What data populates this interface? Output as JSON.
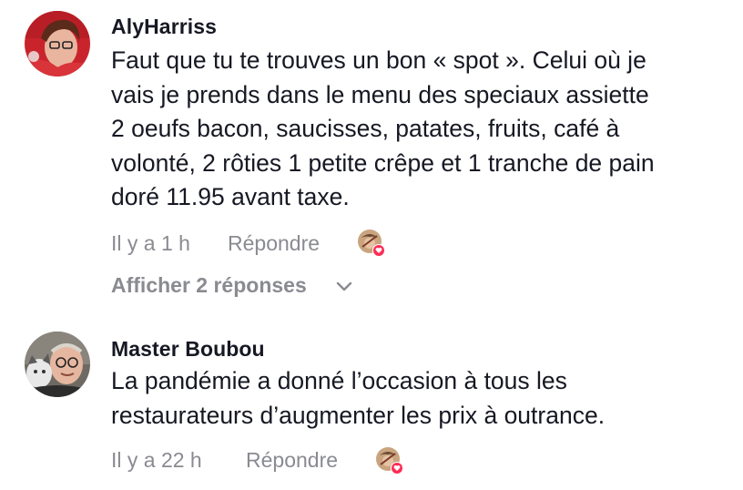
{
  "comments": [
    {
      "username": "AlyHarriss",
      "text_lines": [
        "Faut que tu te trouves un bon « spot ». Celui où je",
        "vais je prends dans le menu des speciaux assiette",
        "2 oeufs bacon, saucisses, patates, fruits, café à",
        "volonté, 2 rôties 1 petite crêpe et 1 tranche de pain",
        "doré 11.95 avant taxe."
      ],
      "time": "Il y a 1 h",
      "reply_label": "Répondre",
      "show_replies_label": "Afficher 2 réponses"
    },
    {
      "username": "Master Boubou",
      "text_lines": [
        "La pandémie a donné l’occasion à tous les",
        "restaurateurs d’augmenter les prix à outrance."
      ],
      "time": "Il y a 22 h",
      "reply_label": "Répondre"
    }
  ],
  "icons": {
    "liked_by_creator": "creator-avatar-with-heart-icon",
    "expand": "chevron-down-icon"
  },
  "colors": {
    "text": "#161823",
    "secondary": "#8a8b91",
    "heart": "#fe2c55"
  }
}
